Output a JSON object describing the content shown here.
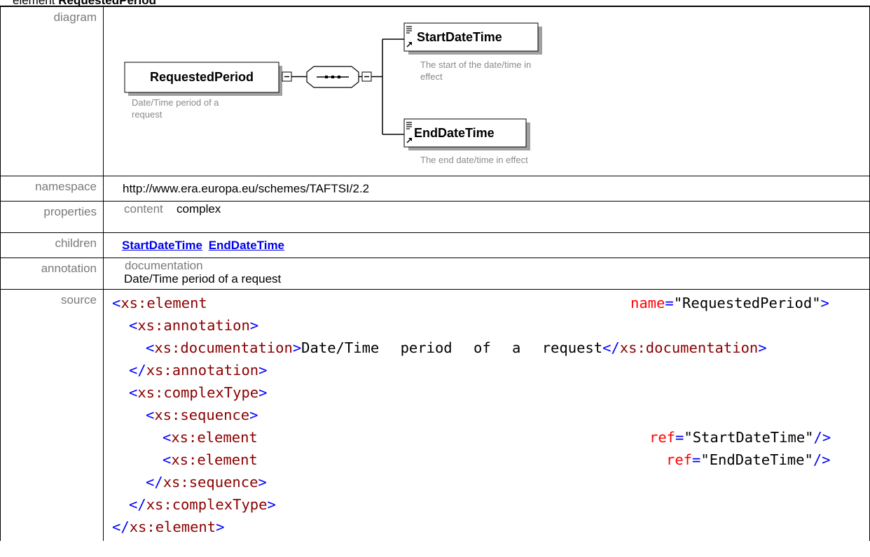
{
  "heading": {
    "prefix": "element",
    "name": "RequestedPeriod"
  },
  "labels": {
    "diagram": "diagram",
    "namespace": "namespace",
    "properties": "properties",
    "children": "children",
    "annotation": "annotation",
    "source": "source"
  },
  "diagram": {
    "root_name": "RequestedPeriod",
    "root_desc_line1": "Date/Time period of a",
    "root_desc_line2": "request",
    "child1_name": "StartDateTime",
    "child1_desc_line1": "The start of the date/time in",
    "child1_desc_line2": "effect",
    "child2_name": "EndDateTime",
    "child2_desc": "The end date/time in effect"
  },
  "namespace": "http://www.era.europa.eu/schemes/TAFTSI/2.2",
  "properties": {
    "key": "content",
    "value": "complex"
  },
  "children": [
    "StartDateTime",
    "EndDateTime"
  ],
  "annotation": {
    "key": "documentation",
    "value": "Date/Time period of a request"
  },
  "source": {
    "l1_tag": "xs:element",
    "l1_attr": "name",
    "l1_val": "\"RequestedPeriod\"",
    "l2_tag": "xs:annotation",
    "l3_tag": "xs:documentation",
    "l3_text": "Date/Time period of a request",
    "l3_close": "xs:documentation",
    "l4_close": "xs:annotation",
    "l5_tag": "xs:complexType",
    "l6_tag": "xs:sequence",
    "l7_tag": "xs:element",
    "l7_attr": "ref",
    "l7_val": "\"StartDateTime\"",
    "l8_tag": "xs:element",
    "l8_attr": "ref",
    "l8_val": "\"EndDateTime\"",
    "l9_close": "xs:sequence",
    "l10_close": "xs:complexType",
    "l11_close": "xs:element"
  }
}
